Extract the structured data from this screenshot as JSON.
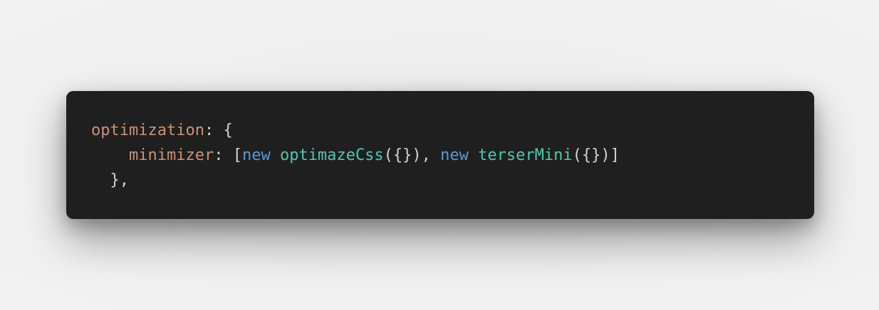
{
  "colors": {
    "background": "#efefef",
    "card": "#1f1f1f",
    "property": "#ce9178",
    "keyword": "#569cd6",
    "class": "#4ec9b0",
    "punctuation": "#d4d4d4"
  },
  "code": {
    "line1": {
      "prop": "optimization",
      "rest": ": {"
    },
    "line2": {
      "indent": "    ",
      "prop": "minimizer",
      "p1": ": [",
      "kw1": "new",
      "sp1": " ",
      "cls1": "optimazeCss",
      "p2": "({}), ",
      "kw2": "new",
      "sp2": " ",
      "cls2": "terserMini",
      "p3": "({})]"
    },
    "line3": {
      "text": "  },"
    }
  }
}
